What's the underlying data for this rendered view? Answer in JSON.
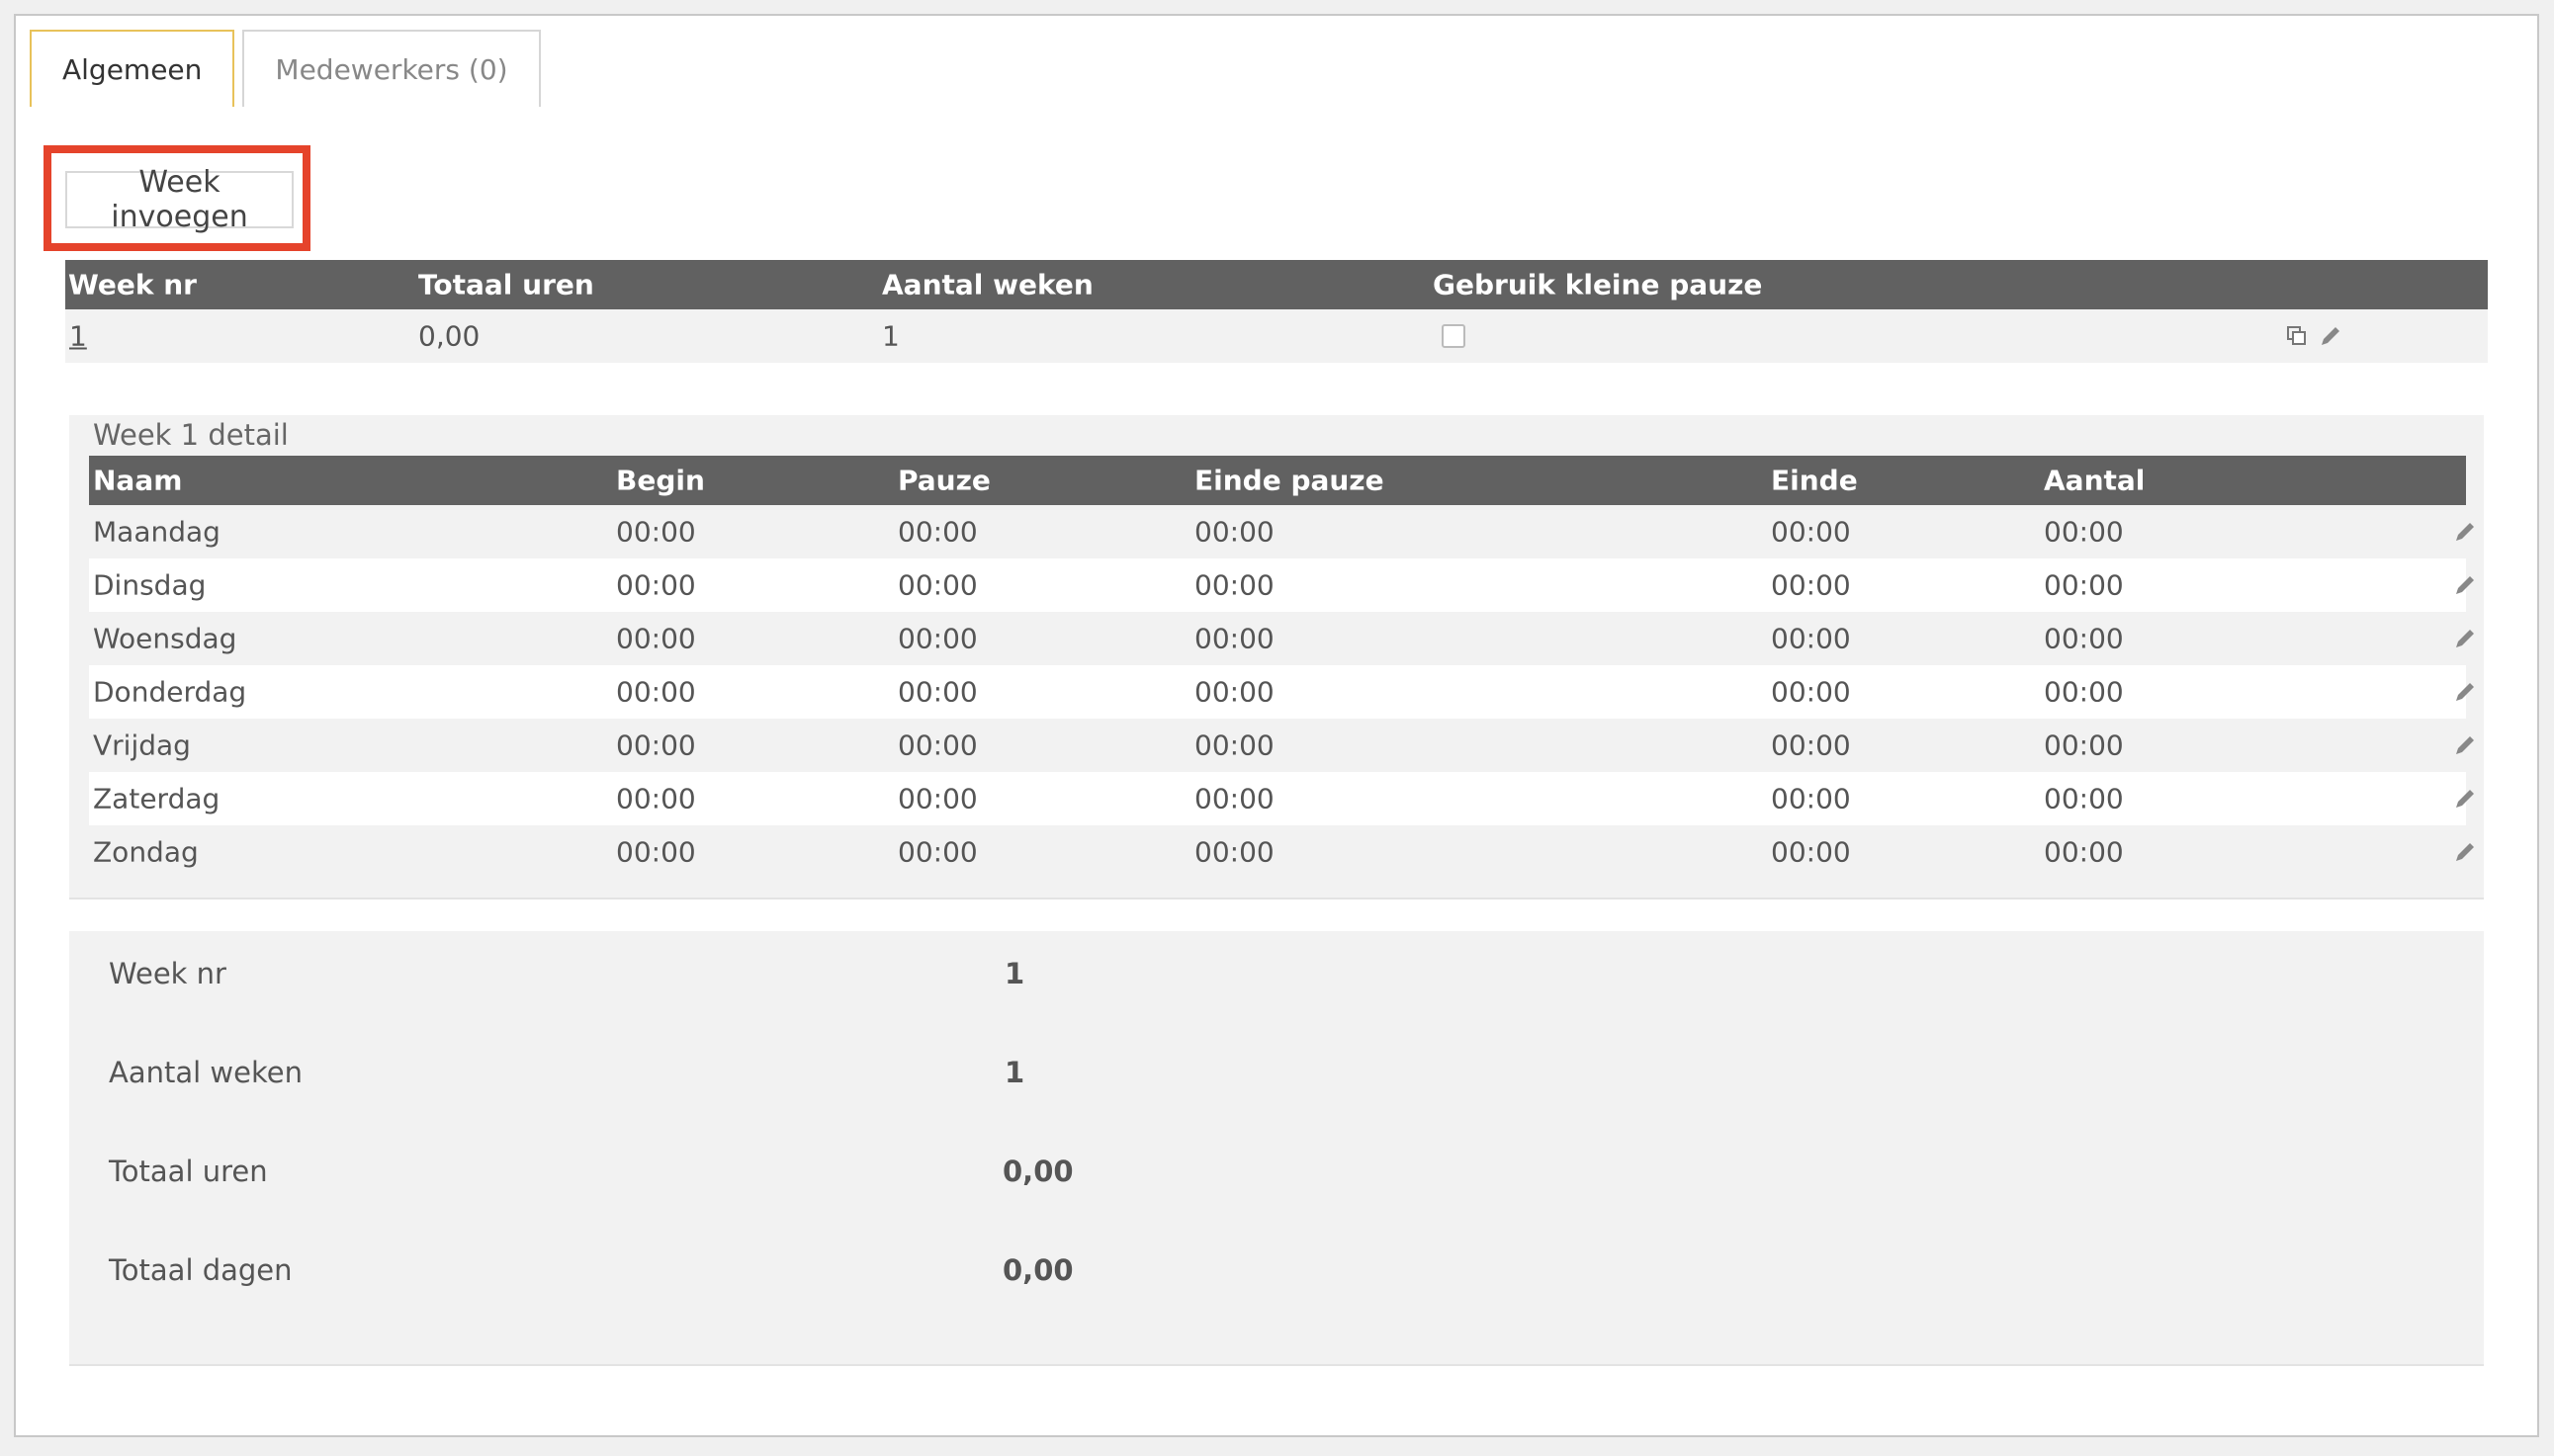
{
  "tabs": [
    {
      "label": "Algemeen",
      "active": true
    },
    {
      "label": "Medewerkers (0)",
      "active": false
    }
  ],
  "toolbar": {
    "add_week_label": "Week invoegen"
  },
  "week_table": {
    "headers": [
      "Week nr",
      "Totaal uren",
      "Aantal weken",
      "Gebruik kleine pauze"
    ],
    "rows": [
      {
        "week_nr": "1",
        "totaal_uren": "0,00",
        "aantal_weken": "1",
        "kleine_pauze": false
      }
    ]
  },
  "detail": {
    "title": "Week 1 detail",
    "headers": [
      "Naam",
      "Begin",
      "Pauze",
      "Einde pauze",
      "Einde",
      "Aantal"
    ],
    "rows": [
      {
        "naam": "Maandag",
        "begin": "00:00",
        "pauze": "00:00",
        "einde_pauze": "00:00",
        "einde": "00:00",
        "aantal": "00:00"
      },
      {
        "naam": "Dinsdag",
        "begin": "00:00",
        "pauze": "00:00",
        "einde_pauze": "00:00",
        "einde": "00:00",
        "aantal": "00:00"
      },
      {
        "naam": "Woensdag",
        "begin": "00:00",
        "pauze": "00:00",
        "einde_pauze": "00:00",
        "einde": "00:00",
        "aantal": "00:00"
      },
      {
        "naam": "Donderdag",
        "begin": "00:00",
        "pauze": "00:00",
        "einde_pauze": "00:00",
        "einde": "00:00",
        "aantal": "00:00"
      },
      {
        "naam": "Vrijdag",
        "begin": "00:00",
        "pauze": "00:00",
        "einde_pauze": "00:00",
        "einde": "00:00",
        "aantal": "00:00"
      },
      {
        "naam": "Zaterdag",
        "begin": "00:00",
        "pauze": "00:00",
        "einde_pauze": "00:00",
        "einde": "00:00",
        "aantal": "00:00"
      },
      {
        "naam": "Zondag",
        "begin": "00:00",
        "pauze": "00:00",
        "einde_pauze": "00:00",
        "einde": "00:00",
        "aantal": "00:00"
      }
    ]
  },
  "summary": {
    "week_nr_label": "Week nr",
    "week_nr": "1",
    "aantal_weken_label": "Aantal weken",
    "aantal_weken": "1",
    "totaal_uren_label": "Totaal uren",
    "totaal_uren": "0,00",
    "totaal_dagen_label": "Totaal dagen",
    "totaal_dagen": "0,00"
  },
  "colors": {
    "highlight": "#e5432b",
    "active_tab_border": "#e8c25a",
    "table_header": "#616161"
  },
  "icons": {
    "copy": "copy-icon",
    "edit": "pencil-icon"
  }
}
